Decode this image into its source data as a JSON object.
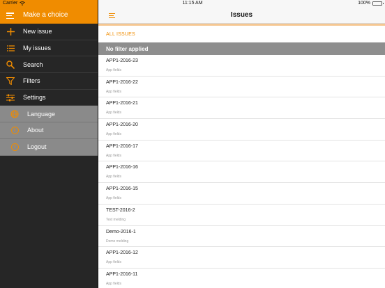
{
  "status": {
    "carrier": "Carrier",
    "time": "11:15 AM",
    "battery": "100%"
  },
  "sidebar": {
    "header_label": "Make a choice",
    "items": [
      {
        "label": "New issue",
        "icon": "plus-icon"
      },
      {
        "label": "My issues",
        "icon": "list-icon"
      },
      {
        "label": "Search",
        "icon": "search-icon"
      },
      {
        "label": "Filters",
        "icon": "filter-icon"
      },
      {
        "label": "Settings",
        "icon": "sliders-icon"
      }
    ],
    "sub_items": [
      {
        "label": "Language",
        "icon": "globe-icon"
      },
      {
        "label": "About",
        "icon": "info-icon"
      },
      {
        "label": "Logout",
        "icon": "logout-icon"
      }
    ]
  },
  "main": {
    "title": "Issues",
    "tab_label": "ALL ISSUES",
    "filter_label": "No filter applied",
    "issues": [
      {
        "code": "APP1-2016-23",
        "sub": "App fields"
      },
      {
        "code": "APP1-2016-22",
        "sub": "App fields"
      },
      {
        "code": "APP1-2016-21",
        "sub": "App fields"
      },
      {
        "code": "APP1-2016-20",
        "sub": "App fields"
      },
      {
        "code": "APP1-2016-17",
        "sub": "App fields"
      },
      {
        "code": "APP1-2016-16",
        "sub": "App fields"
      },
      {
        "code": "APP1-2016-15",
        "sub": "App fields"
      },
      {
        "code": "TEST-2016-2",
        "sub": "Test melding"
      },
      {
        "code": "Demo-2016-1",
        "sub": "Demo melding"
      },
      {
        "code": "APP1-2016-12",
        "sub": "App fields"
      },
      {
        "code": "APP1-2016-11",
        "sub": "App fields"
      }
    ]
  },
  "colors": {
    "accent": "#f08c00",
    "sidebar_bg": "#262626",
    "sub_bg": "#8a8a8a",
    "filter_bar": "#8e8e8e"
  }
}
